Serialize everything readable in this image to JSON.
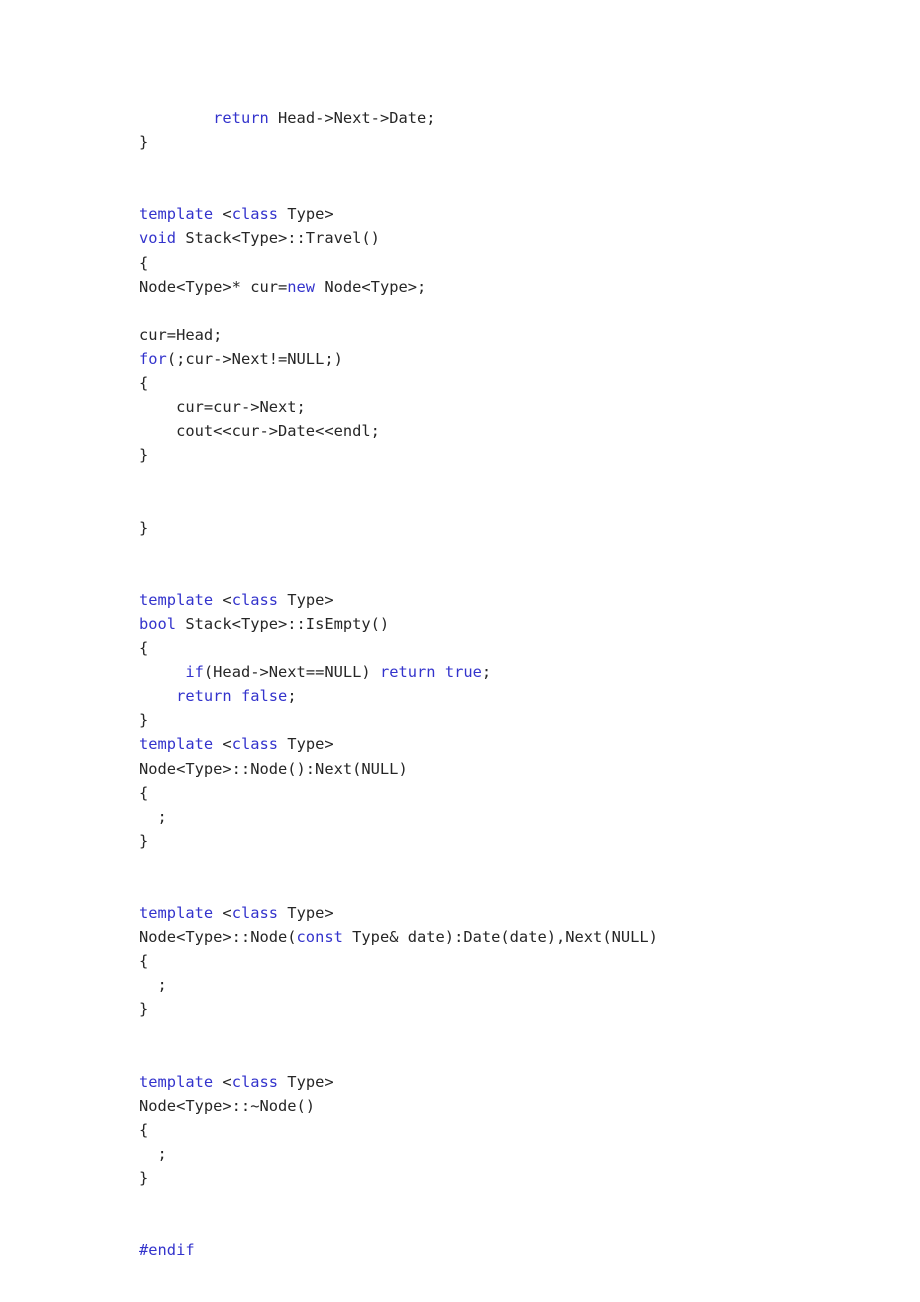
{
  "document": {
    "kind": "source-code-listing",
    "language": "C++",
    "background_color": "#ffffff",
    "text_color": "#262626",
    "keyword_color": "#3333cc"
  },
  "code": {
    "lines": [
      {
        "indent": 8,
        "tokens": [
          {
            "t": "return",
            "k": true
          },
          {
            "t": " Head->Next->Date;",
            "k": false
          }
        ]
      },
      {
        "indent": 0,
        "tokens": [
          {
            "t": "}",
            "k": false
          }
        ]
      },
      {
        "indent": 0,
        "tokens": []
      },
      {
        "indent": 0,
        "tokens": []
      },
      {
        "indent": 0,
        "tokens": [
          {
            "t": "template",
            "k": true
          },
          {
            "t": " <",
            "k": false
          },
          {
            "t": "class",
            "k": true
          },
          {
            "t": " Type>",
            "k": false
          }
        ]
      },
      {
        "indent": 0,
        "tokens": [
          {
            "t": "void",
            "k": true
          },
          {
            "t": " Stack<Type>::Travel()",
            "k": false
          }
        ]
      },
      {
        "indent": 0,
        "tokens": [
          {
            "t": "{",
            "k": false
          }
        ]
      },
      {
        "indent": 0,
        "tokens": [
          {
            "t": "Node<Type>* cur=",
            "k": false
          },
          {
            "t": "new",
            "k": true
          },
          {
            "t": " Node<Type>;",
            "k": false
          }
        ]
      },
      {
        "indent": 0,
        "tokens": []
      },
      {
        "indent": 0,
        "tokens": [
          {
            "t": "cur=Head;",
            "k": false
          }
        ]
      },
      {
        "indent": 0,
        "tokens": [
          {
            "t": "for",
            "k": true
          },
          {
            "t": "(;cur->Next!=NULL;)",
            "k": false
          }
        ]
      },
      {
        "indent": 0,
        "tokens": [
          {
            "t": "{",
            "k": false
          }
        ]
      },
      {
        "indent": 4,
        "tokens": [
          {
            "t": "cur=cur->Next;",
            "k": false
          }
        ]
      },
      {
        "indent": 4,
        "tokens": [
          {
            "t": "cout<<cur->Date<<endl;",
            "k": false
          }
        ]
      },
      {
        "indent": 0,
        "tokens": [
          {
            "t": "}",
            "k": false
          }
        ]
      },
      {
        "indent": 0,
        "tokens": []
      },
      {
        "indent": 0,
        "tokens": []
      },
      {
        "indent": 0,
        "tokens": [
          {
            "t": "}",
            "k": false
          }
        ]
      },
      {
        "indent": 0,
        "tokens": []
      },
      {
        "indent": 0,
        "tokens": []
      },
      {
        "indent": 0,
        "tokens": [
          {
            "t": "template",
            "k": true
          },
          {
            "t": " <",
            "k": false
          },
          {
            "t": "class",
            "k": true
          },
          {
            "t": " Type>",
            "k": false
          }
        ]
      },
      {
        "indent": 0,
        "tokens": [
          {
            "t": "bool",
            "k": true
          },
          {
            "t": " Stack<Type>::IsEmpty()",
            "k": false
          }
        ]
      },
      {
        "indent": 0,
        "tokens": [
          {
            "t": "{",
            "k": false
          }
        ]
      },
      {
        "indent": 5,
        "tokens": [
          {
            "t": "if",
            "k": true
          },
          {
            "t": "(Head->Next==NULL) ",
            "k": false
          },
          {
            "t": "return",
            "k": true
          },
          {
            "t": " ",
            "k": false
          },
          {
            "t": "true",
            "k": true
          },
          {
            "t": ";",
            "k": false
          }
        ]
      },
      {
        "indent": 4,
        "tokens": [
          {
            "t": "return",
            "k": true
          },
          {
            "t": " ",
            "k": false
          },
          {
            "t": "false",
            "k": true
          },
          {
            "t": ";",
            "k": false
          }
        ]
      },
      {
        "indent": 0,
        "tokens": [
          {
            "t": "}",
            "k": false
          }
        ]
      },
      {
        "indent": 0,
        "tokens": [
          {
            "t": "template",
            "k": true
          },
          {
            "t": " <",
            "k": false
          },
          {
            "t": "class",
            "k": true
          },
          {
            "t": " Type>",
            "k": false
          }
        ]
      },
      {
        "indent": 0,
        "tokens": [
          {
            "t": "Node<Type>::Node():Next(NULL)",
            "k": false
          }
        ]
      },
      {
        "indent": 0,
        "tokens": [
          {
            "t": "{",
            "k": false
          }
        ]
      },
      {
        "indent": 2,
        "tokens": [
          {
            "t": ";",
            "k": false
          }
        ]
      },
      {
        "indent": 0,
        "tokens": [
          {
            "t": "}",
            "k": false
          }
        ]
      },
      {
        "indent": 0,
        "tokens": []
      },
      {
        "indent": 0,
        "tokens": []
      },
      {
        "indent": 0,
        "tokens": [
          {
            "t": "template",
            "k": true
          },
          {
            "t": " <",
            "k": false
          },
          {
            "t": "class",
            "k": true
          },
          {
            "t": " Type>",
            "k": false
          }
        ]
      },
      {
        "indent": 0,
        "tokens": [
          {
            "t": "Node<Type>::Node(",
            "k": false
          },
          {
            "t": "const",
            "k": true
          },
          {
            "t": " Type& date):Date(date),Next(NULL)",
            "k": false
          }
        ]
      },
      {
        "indent": 0,
        "tokens": [
          {
            "t": "{",
            "k": false
          }
        ]
      },
      {
        "indent": 2,
        "tokens": [
          {
            "t": ";",
            "k": false
          }
        ]
      },
      {
        "indent": 0,
        "tokens": [
          {
            "t": "}",
            "k": false
          }
        ]
      },
      {
        "indent": 0,
        "tokens": []
      },
      {
        "indent": 0,
        "tokens": []
      },
      {
        "indent": 0,
        "tokens": [
          {
            "t": "template",
            "k": true
          },
          {
            "t": " <",
            "k": false
          },
          {
            "t": "class",
            "k": true
          },
          {
            "t": " Type>",
            "k": false
          }
        ]
      },
      {
        "indent": 0,
        "tokens": [
          {
            "t": "Node<Type>::~Node()",
            "k": false
          }
        ]
      },
      {
        "indent": 0,
        "tokens": [
          {
            "t": "{",
            "k": false
          }
        ]
      },
      {
        "indent": 2,
        "tokens": [
          {
            "t": ";",
            "k": false
          }
        ]
      },
      {
        "indent": 0,
        "tokens": [
          {
            "t": "}",
            "k": false
          }
        ]
      },
      {
        "indent": 0,
        "tokens": []
      },
      {
        "indent": 0,
        "tokens": []
      },
      {
        "indent": 0,
        "tokens": [
          {
            "t": "#endif",
            "k": true
          }
        ]
      }
    ]
  }
}
